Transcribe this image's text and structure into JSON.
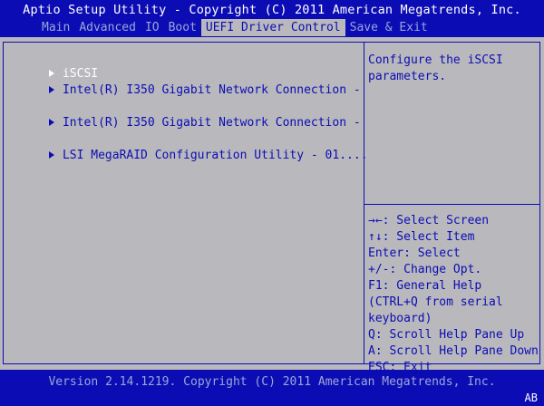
{
  "header": {
    "title": "Aptio Setup Utility - Copyright (C) 2011 American Megatrends, Inc.",
    "tabs": [
      {
        "label": "Main"
      },
      {
        "label": "Advanced"
      },
      {
        "label": "IO"
      },
      {
        "label": "Boot"
      },
      {
        "label": "UEFI Driver Control"
      },
      {
        "label": "Save & Exit"
      }
    ],
    "active_tab": "UEFI Driver Control"
  },
  "menu": {
    "items": [
      {
        "label": "iSCSI",
        "selected": true
      },
      {
        "label": "Intel(R) I350 Gigabit Network Connection -"
      },
      {
        "label": "Intel(R) I350 Gigabit Network Connection -"
      },
      {
        "label": "LSI MegaRAID Configuration Utility - 01...."
      }
    ]
  },
  "help": {
    "text": "Configure the iSCSI\nparameters."
  },
  "keys": [
    {
      "text": "→←: Select Screen"
    },
    {
      "text": "↑↓: Select Item"
    },
    {
      "text": "Enter: Select"
    },
    {
      "text": "+/-: Change Opt."
    },
    {
      "text": "F1: General Help"
    },
    {
      "text": "(CTRL+Q from serial"
    },
    {
      "text": "keyboard)"
    },
    {
      "text": "Q: Scroll Help Pane Up"
    },
    {
      "text": "A: Scroll Help Pane Down"
    },
    {
      "text": "ESC: Exit"
    }
  ],
  "footer": {
    "version": "Version 2.14.1219. Copyright (C) 2011 American Megatrends, Inc.",
    "badge": "AB"
  },
  "colors": {
    "bios_blue": "#0c0cb4",
    "panel_gray": "#b9b9bd",
    "inactive_text": "#9aa7d8",
    "selected_text": "#ffffff"
  }
}
